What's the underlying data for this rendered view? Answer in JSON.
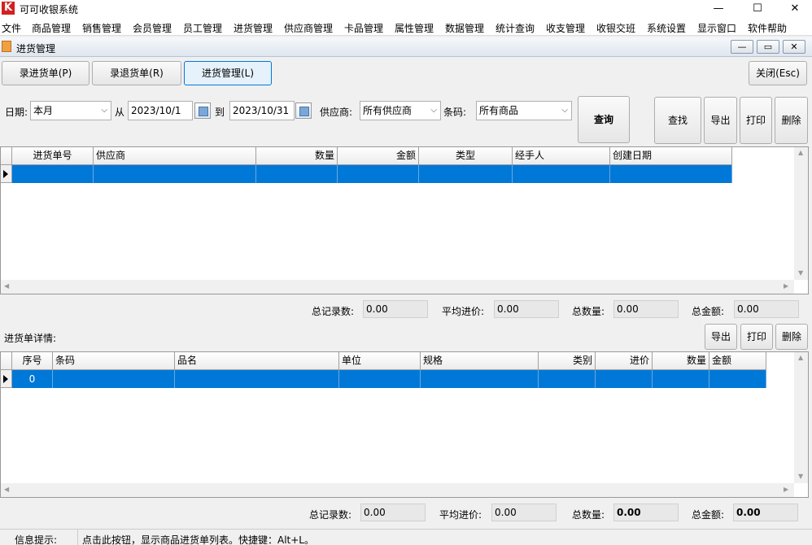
{
  "app": {
    "logo": "K",
    "title": "可可收银系统"
  },
  "window_controls": {
    "minimize": "—",
    "maximize": "☐",
    "close": "✕"
  },
  "menu": [
    "文件",
    "商品管理",
    "销售管理",
    "会员管理",
    "员工管理",
    "进货管理",
    "供应商管理",
    "卡品管理",
    "属性管理",
    "数据管理",
    "统计查询",
    "收支管理",
    "收银交班",
    "系统设置",
    "显示窗口",
    "软件帮助"
  ],
  "child_window": {
    "title": "进货管理",
    "controls": {
      "minimize": "—",
      "restore": "▭",
      "close": "✕"
    }
  },
  "tabs": {
    "entry": "录进货单(P)",
    "return": "录退货单(R)",
    "manage": "进货管理(L)"
  },
  "close_button": "关闭(Esc)",
  "filter": {
    "date_label": "日期:",
    "date_range": "本月",
    "from_label": "从",
    "from_date": "2023/10/1",
    "to_label": "到",
    "to_date": "2023/10/31",
    "supplier_label": "供应商:",
    "supplier": "所有供应商",
    "barcode_label": "条码:",
    "barcode": "所有商品",
    "query_button": "查询"
  },
  "actions": {
    "find": "查找",
    "export": "导出",
    "print": "打印",
    "delete": "删除"
  },
  "main_table": {
    "columns": [
      "进货单号",
      "供应商",
      "数量",
      "金额",
      "类型",
      "经手人",
      "创建日期"
    ],
    "rows": [
      [
        "",
        "",
        "",
        "",
        "",
        "",
        ""
      ]
    ]
  },
  "main_summary": {
    "records_label": "总记录数:",
    "records": "0.00",
    "avg_label": "平均进价:",
    "avg": "0.00",
    "qty_label": "总数量:",
    "qty": "0.00",
    "amount_label": "总金额:",
    "amount": "0.00"
  },
  "detail": {
    "title": "进货单详情:",
    "actions": {
      "export": "导出",
      "print": "打印",
      "delete": "删除"
    },
    "columns": [
      "序号",
      "条码",
      "品名",
      "单位",
      "规格",
      "类别",
      "进价",
      "数量",
      "金额"
    ],
    "rows": [
      [
        "0",
        "",
        "",
        "",
        "",
        "",
        "",
        "",
        ""
      ]
    ]
  },
  "detail_summary": {
    "records_label": "总记录数:",
    "records": "0.00",
    "avg_label": "平均进价:",
    "avg": "0.00",
    "qty_label": "总数量:",
    "qty": "0.00",
    "amount_label": "总金额:",
    "amount": "0.00"
  },
  "status": {
    "label": "信息提示:",
    "message": "点击此按钮，显示商品进货单列表。快捷键：Alt+L。"
  }
}
